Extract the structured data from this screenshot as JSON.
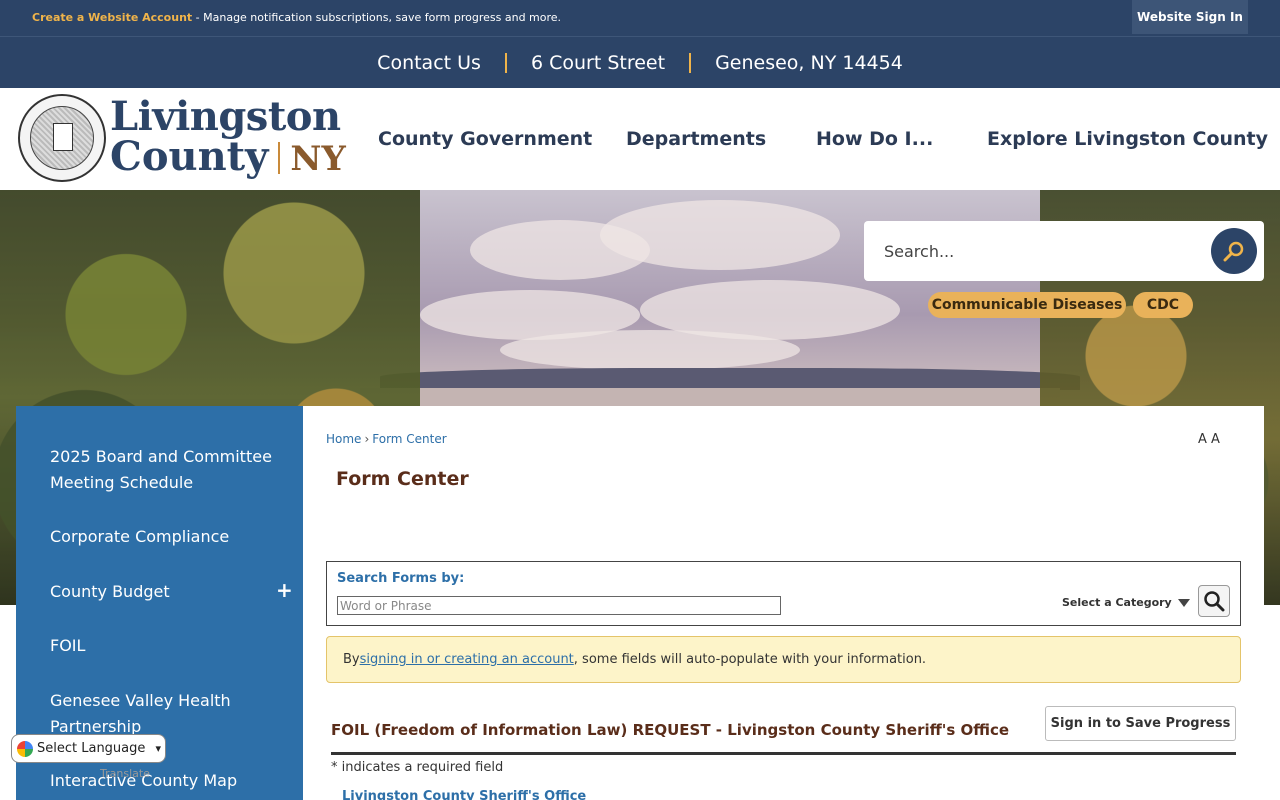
{
  "util_bar": {
    "create_account": "Create a Website Account",
    "tagline": " - Manage notification subscriptions, save form progress and more.",
    "sign_in": "Website Sign In"
  },
  "contact": {
    "items": [
      "Contact Us",
      "6 Court Street",
      "Geneseo, NY 14454"
    ]
  },
  "logo": {
    "line1": "Livingston",
    "line2": "County",
    "ny": "NY"
  },
  "nav": {
    "items": [
      "County Government",
      "Departments",
      "How Do I...",
      "Explore Livingston County"
    ]
  },
  "search": {
    "placeholder": "Search..."
  },
  "quick_links": [
    "Communicable Diseases",
    "CDC"
  ],
  "sidebar": {
    "items": [
      "2025 Board and Committee Meeting Schedule",
      "Corporate Compliance",
      "County Budget",
      "FOIL",
      "Genesee Valley Health Partnership",
      "Interactive County Map"
    ],
    "expand": "+"
  },
  "breadcrumb": [
    "Home",
    "Form Center"
  ],
  "breadcrumb_sep": "›",
  "text_resize": "A A",
  "page_title": "Form Center",
  "search_forms": {
    "label": "Search Forms by:",
    "placeholder": "Word or Phrase",
    "category": "Select a Category"
  },
  "notice": {
    "before": "By ",
    "link": "signing in or creating an account",
    "after": ", some fields will auto-populate with your information."
  },
  "form": {
    "title": "FOIL (Freedom of Information Law) REQUEST - Livingston County Sheriff's Office",
    "save_button": "Sign in to Save Progress",
    "required_note": "* indicates a required field",
    "sub_link": "Livingston County Sheriff's Office"
  },
  "translate": {
    "select": "Select Language",
    "powered": "Translate"
  },
  "colors": {
    "navy": "#2c4467",
    "gold": "#e9b25a",
    "sidebar_blue": "#2d6fa8",
    "title_brown": "#5a2d1a"
  }
}
